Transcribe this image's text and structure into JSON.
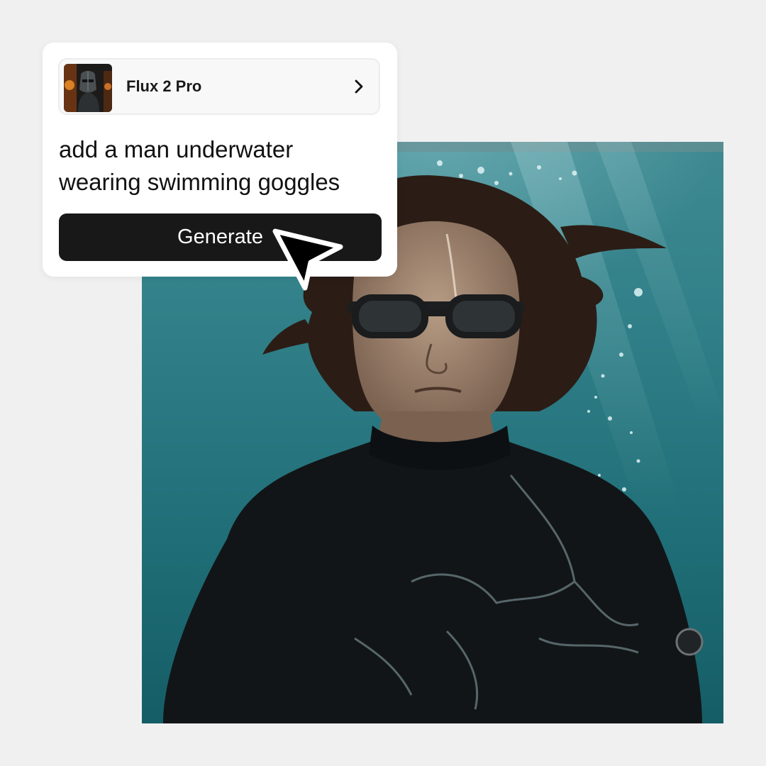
{
  "card": {
    "model_name": "Flux 2 Pro",
    "model_thumbnail_icon": "knight-thumbnail-image",
    "chevron_icon": "chevron-right-icon",
    "prompt_line_1": "add a man underwater",
    "prompt_line_2": "wearing swimming goggles",
    "generate_label": "Generate"
  },
  "cursor_icon": "pointer-arrow-icon",
  "result_image": "underwater-man-goggles-photo",
  "colors": {
    "page_background": "#f0f0f0",
    "card_background": "#ffffff",
    "button_background": "#181818",
    "button_text": "#ffffff",
    "water": "#2f7e87",
    "wetsuit": "#121517"
  }
}
